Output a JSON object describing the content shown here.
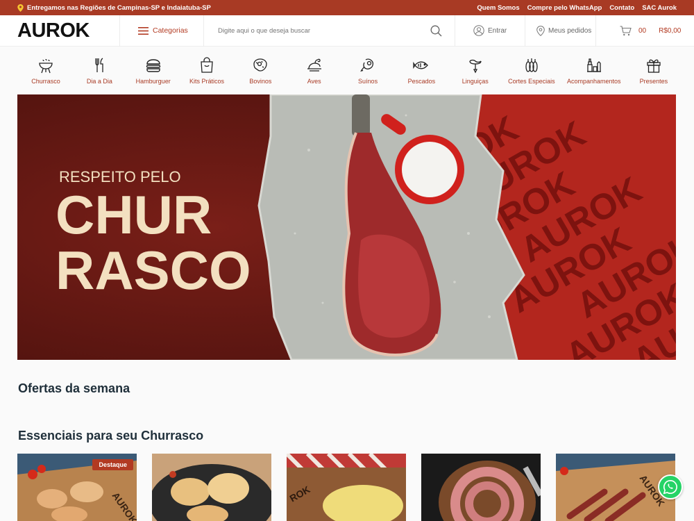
{
  "topbar": {
    "delivery": "Entregamos nas Regiões de Campinas-SP e Indaiatuba-SP",
    "links": [
      "Quem Somos",
      "Compre pelo WhatsApp",
      "Contato",
      "SAC Aurok"
    ]
  },
  "header": {
    "logo": "AUROK",
    "categories_label": "Categorias",
    "search_placeholder": "Digite aqui o que deseja buscar",
    "login_label": "Entrar",
    "orders_label": "Meus pedidos",
    "cart_count": "00",
    "cart_total": "R$0,00"
  },
  "categories": [
    {
      "label": "Churrasco",
      "icon": "grill-icon"
    },
    {
      "label": "Dia a Dia",
      "icon": "cutlery-icon"
    },
    {
      "label": "Hamburguer",
      "icon": "burger-icon"
    },
    {
      "label": "Kits Práticos",
      "icon": "bag-icon"
    },
    {
      "label": "Bovinos",
      "icon": "beef-icon"
    },
    {
      "label": "Aves",
      "icon": "chicken-icon"
    },
    {
      "label": "Suínos",
      "icon": "ham-icon"
    },
    {
      "label": "Pescados",
      "icon": "fish-icon"
    },
    {
      "label": "Linguiças",
      "icon": "sausage-icon"
    },
    {
      "label": "Cortes Especiais",
      "icon": "cuts-icon"
    },
    {
      "label": "Acompanhamentos",
      "icon": "sides-icon"
    },
    {
      "label": "Presentes",
      "icon": "gift-icon"
    }
  ],
  "banner": {
    "line1": "RESPEITO PELO",
    "line2": "CHUR",
    "line3": "RASCO",
    "pattern_text": "AUROK"
  },
  "sections": {
    "offers_title": "Ofertas da semana",
    "essentials_title": "Essenciais para seu Churrasco"
  },
  "products": [
    {
      "badge": "Destaque",
      "label": "AUROK"
    },
    {
      "badge": "",
      "label": ""
    },
    {
      "badge": "",
      "label": "ROK"
    },
    {
      "badge": "",
      "label": ""
    },
    {
      "badge": "",
      "label": "AUROK"
    }
  ],
  "colors": {
    "brand": "#a83a24",
    "dark_red": "#6b1a14",
    "whatsapp": "#25d366"
  }
}
